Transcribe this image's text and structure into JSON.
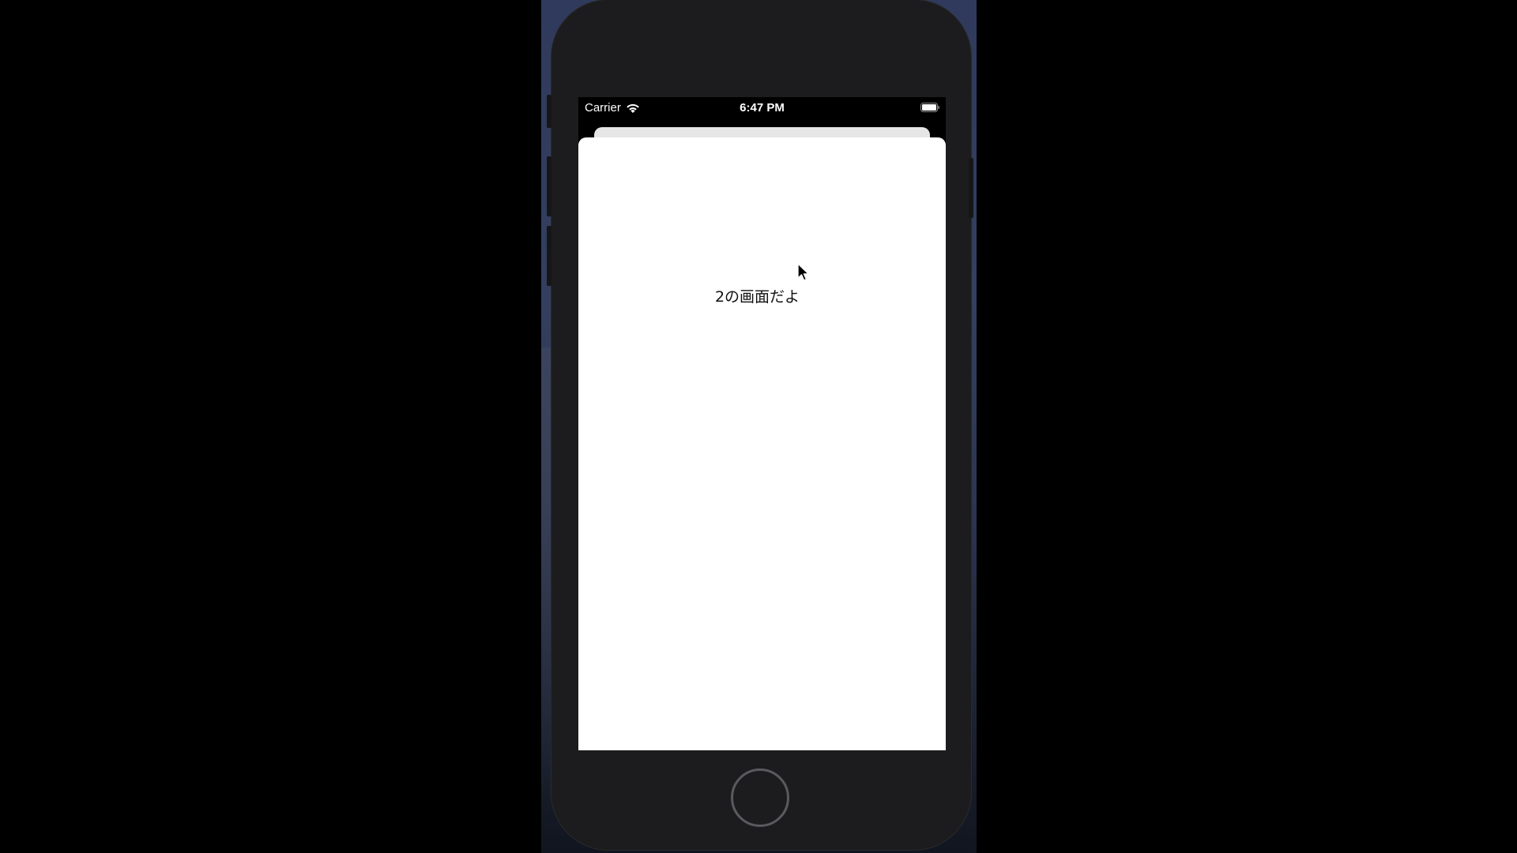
{
  "status_bar": {
    "carrier": "Carrier",
    "time": "6:47 PM",
    "wifi_icon": "wifi-icon",
    "battery_icon": "battery-icon"
  },
  "modal_sheet": {
    "label": "2の画面だよ"
  },
  "device": {
    "home_button_icon": "home-button-circle",
    "pointer_icon": "mouse-pointer-icon"
  },
  "colors": {
    "sheet_background": "#ffffff",
    "phone_body": "#1c1c1e",
    "screen_background": "#000000"
  }
}
